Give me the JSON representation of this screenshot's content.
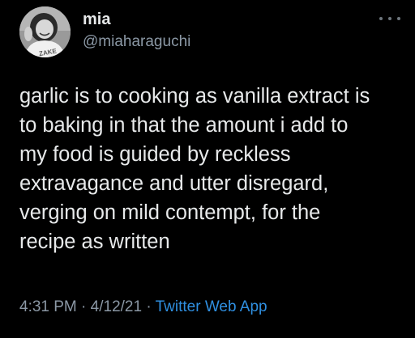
{
  "author": {
    "display_name": "mia",
    "handle": "@miaharaguchi",
    "avatar_icon": "profile-photo",
    "avatar_text": "ZAKE"
  },
  "more_icon": "more-dots-icon",
  "tweet": {
    "lines": [
      "garlic is to cooking as vanilla extract is",
      "to baking in that the amount i add to",
      "my food is guided by reckless",
      "extravagance and utter disregard,",
      "verging on mild contempt, for the",
      "recipe as written"
    ]
  },
  "meta": {
    "time": "4:31 PM",
    "separator": "·",
    "date": "4/12/21",
    "app": "Twitter Web App"
  },
  "colors": {
    "background": "#000000",
    "text": "#e7e9ea",
    "secondary": "#8b98a5",
    "link": "#2f8fe0"
  }
}
